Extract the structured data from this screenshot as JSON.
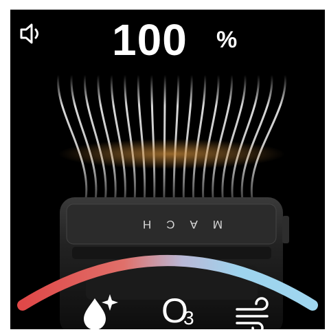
{
  "status": {
    "power_value": "100",
    "power_unit": "%"
  },
  "device": {
    "brand_text": "MACH"
  },
  "modes": {
    "moisture": {
      "icon": "droplet-sparkle-icon"
    },
    "ozone": {
      "letter": "O",
      "subscript": "3"
    },
    "wind": {
      "icon": "wind-icon"
    }
  },
  "icons": {
    "volume": "speaker-icon"
  },
  "colors": {
    "background": "#000000",
    "text": "#ffffff",
    "arc_warm": "#e0504b",
    "arc_cool": "#9fd3ee"
  }
}
